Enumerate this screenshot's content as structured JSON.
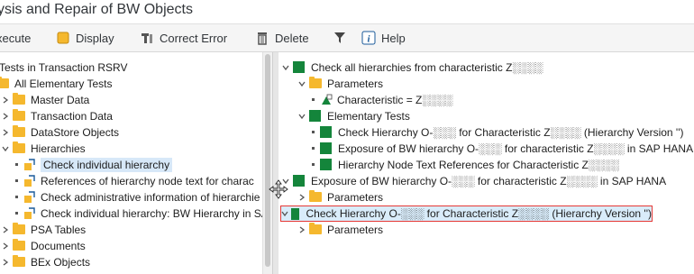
{
  "window": {
    "title": "ysis and Repair of BW Objects"
  },
  "toolbar": {
    "execute": "xecute",
    "display": "Display",
    "correct_error": "Correct Error",
    "delete": "Delete",
    "help": "Help"
  },
  "left_tree": {
    "root": "Tests in Transaction RSRV",
    "all": "All Elementary Tests",
    "items": [
      "Master Data",
      "Transaction Data",
      "DataStore Objects",
      "Hierarchies",
      "Check individual hierarchy",
      "References of hierarchy node text for charac",
      "Check administrative information of hierarchie",
      "Check individual hierarchy: BW Hierarchy in SA",
      "PSA Tables",
      "Documents",
      "BEx Objects"
    ]
  },
  "right_tree": {
    "items": [
      "Check all hierarchies from characteristic Z░░░░",
      "Parameters",
      "Characteristic = Z░░░░",
      "Elementary Tests",
      "Check Hierarchy O-░░░ for Characteristic Z░░░░ (Hierarchy Version '')",
      "Exposure of BW hierarchy O-░░░ for characteristic Z░░░░ in SAP HANA",
      "Hierarchy Node Text References for Characteristic Z░░░░",
      "Exposure of BW hierarchy O-░░░ for characteristic Z░░░░ in SAP HANA",
      "Parameters",
      "Check Hierarchy O-░░░ for Characteristic Z░░░░ (Hierarchy Version '')",
      "Parameters"
    ]
  },
  "colors": {
    "folder": "#f5b82e",
    "status_green": "#14853b",
    "selection": "#d9ecfa",
    "selection_border": "#e53935"
  }
}
